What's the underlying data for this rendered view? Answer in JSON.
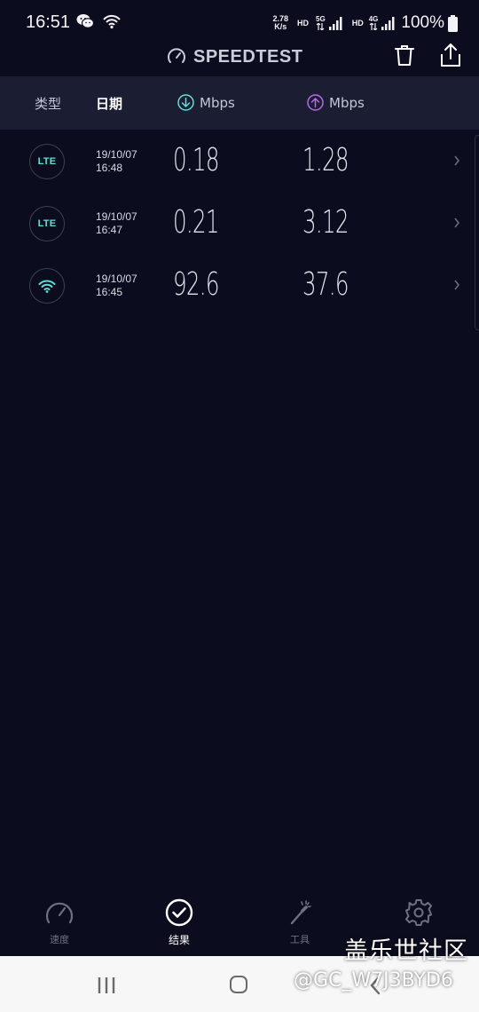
{
  "status_bar": {
    "time": "16:51",
    "net_speed_value": "2.78",
    "net_speed_unit": "K/s",
    "hd1": "HD",
    "net1": "5G",
    "hd2": "HD",
    "net2": "4G",
    "battery": "100%",
    "icons": [
      "wechat-icon",
      "wifi-status-icon",
      "signal-icon",
      "battery-icon"
    ]
  },
  "header": {
    "title": "SPEEDTEST",
    "actions": [
      "trash-icon",
      "share-icon"
    ]
  },
  "columns": {
    "type": "类型",
    "date": "日期",
    "download": "Mbps",
    "upload": "Mbps"
  },
  "results": [
    {
      "type": "LTE",
      "icon": "lte-icon",
      "date": "19/10/07",
      "time": "16:48",
      "download": "0.18",
      "upload": "1.28"
    },
    {
      "type": "LTE",
      "icon": "lte-icon",
      "date": "19/10/07",
      "time": "16:47",
      "download": "0.21",
      "upload": "3.12"
    },
    {
      "type": "WiFi",
      "icon": "wifi-icon",
      "date": "19/10/07",
      "time": "16:45",
      "download": "92.6",
      "upload": "37.6"
    }
  ],
  "bottom_nav": {
    "speed": "速度",
    "results": "结果",
    "tools": "工具",
    "settings": ""
  },
  "watermark": {
    "title": "盖乐世社区",
    "handle": "@GC_W7J3BYD6"
  },
  "colors": {
    "background": "#0b0d1e",
    "header_bar": "#1b1e33",
    "accent_teal": "#5ee0d4",
    "accent_purple": "#b46dde"
  }
}
